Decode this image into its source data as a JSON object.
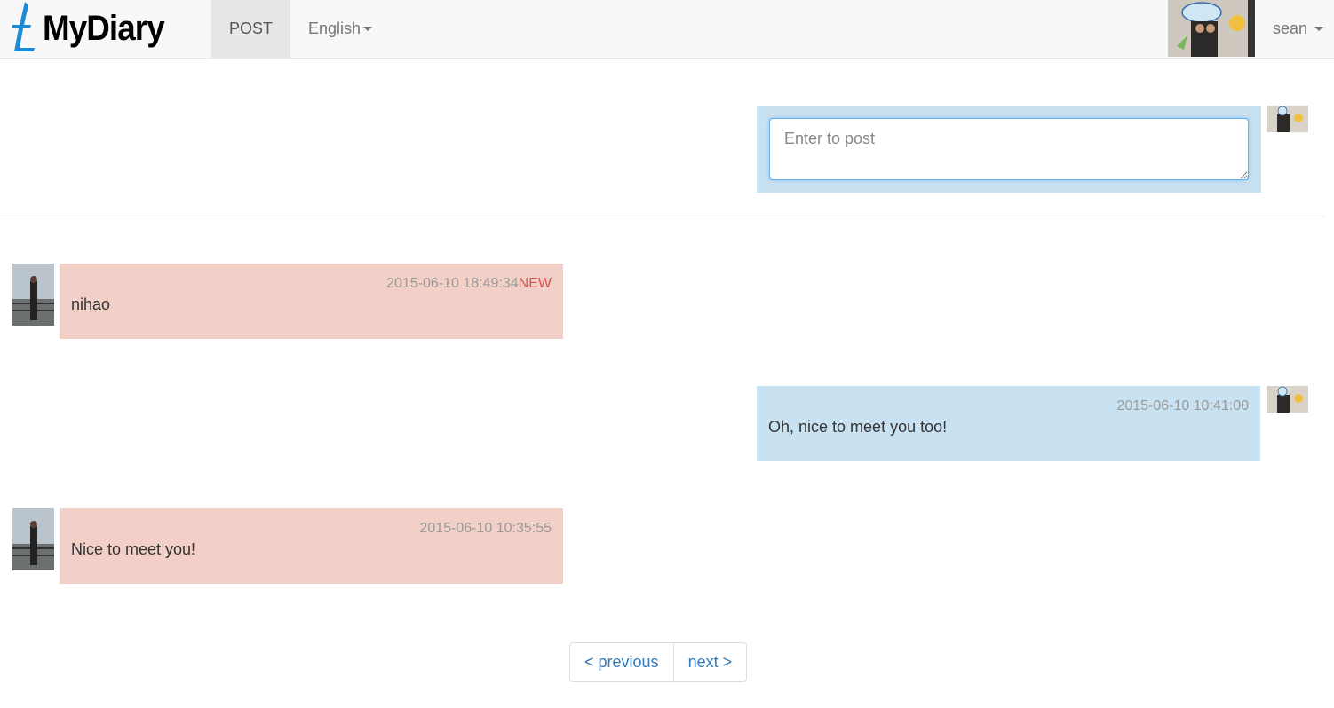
{
  "navbar": {
    "brand": "MyDiary",
    "post_label": "POST",
    "language_label": "English",
    "user_label": "sean"
  },
  "composer": {
    "placeholder": "Enter to post"
  },
  "messages": [
    {
      "side": "left",
      "time": "2015-06-10 18:49:34",
      "badge": "NEW",
      "text": "nihao"
    },
    {
      "side": "right",
      "time": "2015-06-10 10:41:00",
      "badge": "",
      "text": "Oh, nice to meet you too!"
    },
    {
      "side": "left",
      "time": "2015-06-10 10:35:55",
      "badge": "",
      "text": "Nice to meet you!"
    }
  ],
  "pager": {
    "previous": "< previous",
    "next": "next >"
  },
  "colors": {
    "left_bubble": "#f2cfc7",
    "right_bubble": "#c9e2f2",
    "new_badge": "#d9534f",
    "link": "#337ab7"
  }
}
